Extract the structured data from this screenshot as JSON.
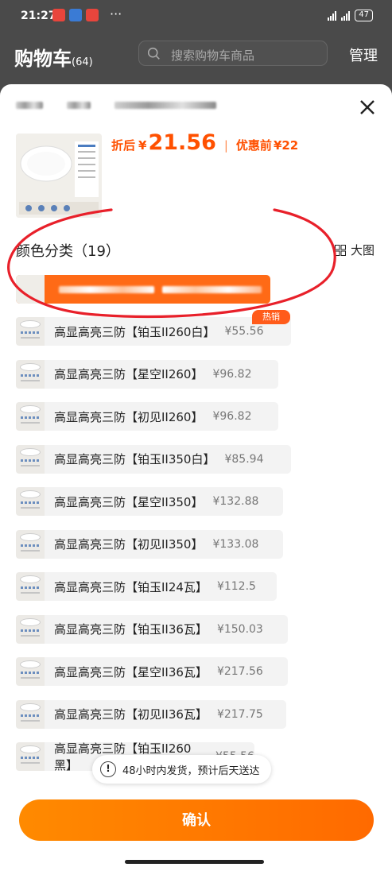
{
  "status_bar": {
    "time": "21:27",
    "battery": "47"
  },
  "cart": {
    "title": "购物车",
    "count": "(64)",
    "search_placeholder": "搜索购物车商品",
    "manage_label": "管理"
  },
  "sheet": {
    "price": {
      "discount_label": "折后",
      "currency": "¥",
      "discount_price": "21.56",
      "separator": "|",
      "original_label": "优惠前",
      "original_price": "¥22"
    },
    "section_title": "颜色分类（19）",
    "big_view_label": "大图",
    "hot_badge": "热销",
    "options": [
      {
        "name": "高显高亮三防【铂玉II260白】",
        "price": "¥55.56"
      },
      {
        "name": "高显高亮三防【星空II260】",
        "price": "¥96.82"
      },
      {
        "name": "高显高亮三防【初见II260】",
        "price": "¥96.82"
      },
      {
        "name": "高显高亮三防【铂玉II350白】",
        "price": "¥85.94"
      },
      {
        "name": "高显高亮三防【星空II350】",
        "price": "¥132.88"
      },
      {
        "name": "高显高亮三防【初见II350】",
        "price": "¥133.08"
      },
      {
        "name": "高显高亮三防【铂玉II24瓦】",
        "price": "¥112.5"
      },
      {
        "name": "高显高亮三防【铂玉II36瓦】",
        "price": "¥150.03"
      },
      {
        "name": "高显高亮三防【星空II36瓦】",
        "price": "¥217.56"
      },
      {
        "name": "高显高亮三防【初见II36瓦】",
        "price": "¥217.75"
      },
      {
        "name": "高显高亮三防【铂玉II260黑】",
        "price": "¥55.56"
      }
    ],
    "notice_icon": "!",
    "notice": "48小时内发货，预计后天送达",
    "confirm_label": "确认"
  },
  "colors": {
    "accent": "#ff5000",
    "button": "#ff7a00",
    "annotation": "#e8202a"
  },
  "icons": [
    "close-icon",
    "grid-icon",
    "search-icon",
    "info-icon"
  ]
}
